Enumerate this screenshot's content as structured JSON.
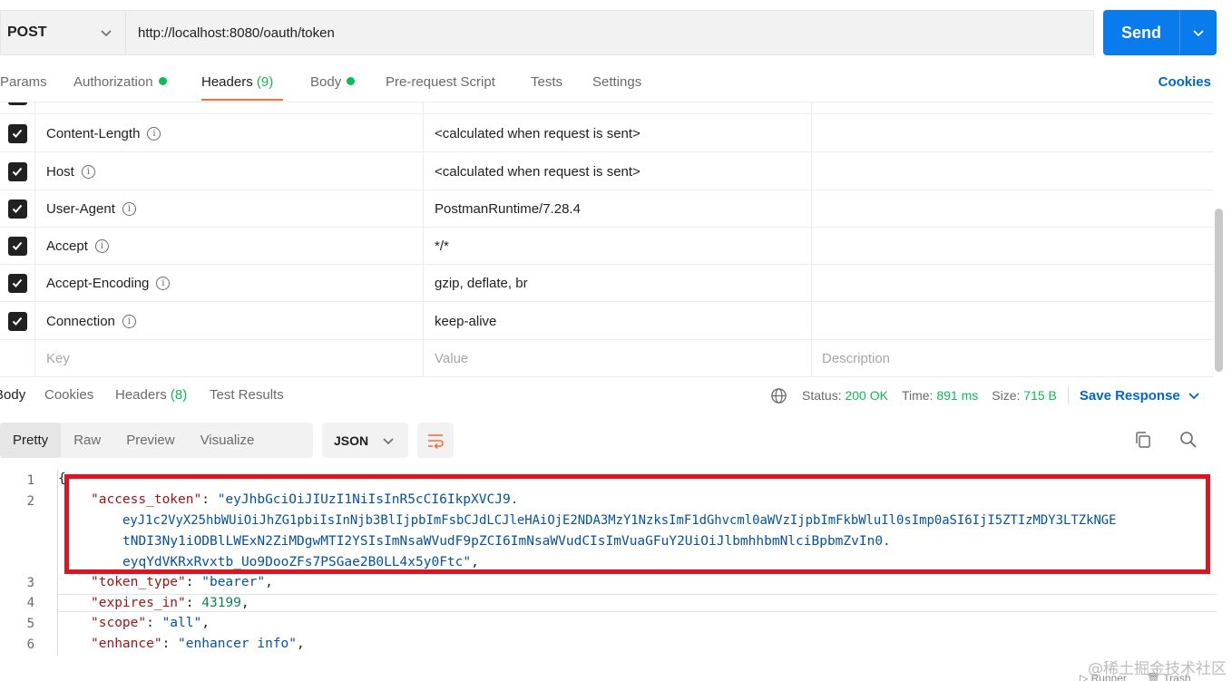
{
  "request": {
    "method": "POST",
    "url": "http://localhost:8080/oauth/token",
    "send_label": "Send"
  },
  "request_tabs": {
    "params": "Params",
    "authorization": "Authorization",
    "headers": "Headers",
    "headers_count": "(9)",
    "body": "Body",
    "prerequest": "Pre-request Script",
    "tests": "Tests",
    "settings": "Settings",
    "cookies": "Cookies"
  },
  "headers_table": {
    "rows": [
      {
        "key": "Content-Length",
        "value": "<calculated when request is sent>"
      },
      {
        "key": "Host",
        "value": "<calculated when request is sent>"
      },
      {
        "key": "User-Agent",
        "value": "PostmanRuntime/7.28.4"
      },
      {
        "key": "Accept",
        "value": "*/*"
      },
      {
        "key": "Accept-Encoding",
        "value": "gzip, deflate, br"
      },
      {
        "key": "Connection",
        "value": "keep-alive"
      }
    ],
    "key_placeholder": "Key",
    "value_placeholder": "Value",
    "description_placeholder": "Description"
  },
  "response_tabs": {
    "body": "Body",
    "cookies": "Cookies",
    "headers": "Headers",
    "headers_count": "(8)",
    "test_results": "Test Results"
  },
  "status": {
    "status_label": "Status:",
    "status_value": "200 OK",
    "time_label": "Time:",
    "time_value": "891 ms",
    "size_label": "Size:",
    "size_value": "715 B",
    "save_response": "Save Response"
  },
  "view_modes": {
    "pretty": "Pretty",
    "raw": "Raw",
    "preview": "Preview",
    "visualize": "Visualize",
    "format": "JSON"
  },
  "code": {
    "line_numbers": [
      "1",
      "2",
      "3",
      "4",
      "5",
      "6"
    ],
    "open_brace": "{",
    "access_token_key": "\"access_token\"",
    "access_token_part1": "\"eyJhbGciOiJIUzI1NiIsInR5cCI6IkpXVCJ9.",
    "access_token_part2": "eyJ1c2VyX25hbWUiOiJhZG1pbiIsInNjb3BlIjpbImFsbCJdLCJleHAiOjE2NDA3MzY1NzksImF1dGhvcml0aWVzIjpbImFkbWluIl0sImp0aSI6IjI5ZTIzMDY3LTZkNGE",
    "access_token_part3": "tNDI3Ny1iODBlLWExN2ZiMDgwMTI2YSIsImNsaWVudF9pZCI6ImNsaWVudCIsImVuaGFuY2UiOiJlbmhhbmNlciBpbmZvIn0.",
    "access_token_part4": "eyqYdVKRxRvxtb_Uo9DooZFs7PSGae2B0LL4x5y0Ftc\"",
    "token_type_key": "\"token_type\"",
    "token_type_value": "\"bearer\"",
    "expires_in_key": "\"expires_in\"",
    "expires_in_value": "43199",
    "scope_key": "\"scope\"",
    "scope_value": "\"all\"",
    "enhance_key": "\"enhance\"",
    "enhance_value": "\"enhancer info\""
  },
  "footer": {
    "runner": "Runner",
    "trash": "Trash"
  },
  "watermark": "@稀土掘金技术社区",
  "colors": {
    "send_blue": "#097bed",
    "active_tab_underline": "#ff6c37",
    "green": "#0cbb52",
    "link_blue": "#0265d2",
    "annotation_red": "#e3121e"
  }
}
